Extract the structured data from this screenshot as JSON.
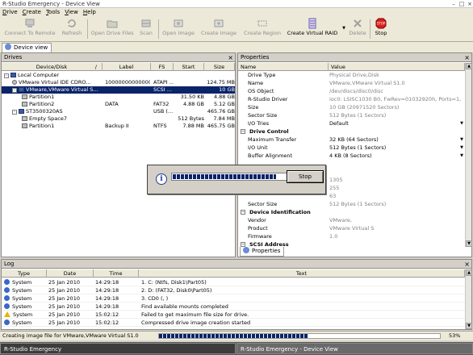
{
  "window": {
    "title": "R-Studio Emergency - Device View"
  },
  "menu": [
    "Drive",
    "Create",
    "Tools",
    "View",
    "Help"
  ],
  "toolbar": {
    "connect": "Connect To Remote",
    "refresh": "Refresh",
    "open_drive_files": "Open Drive Files",
    "scan": "Scan",
    "open_image": "Open Image",
    "create_image": "Create Image",
    "create_region": "Create Region",
    "create_virtual_raid": "Create Virtual RAID",
    "delete": "Delete",
    "stop": "Stop"
  },
  "tabs": {
    "device_view": "Device view",
    "properties": "Properties"
  },
  "drives": {
    "title": "Drives",
    "columns": {
      "device": "Device/Disk",
      "sort": "/",
      "label": "Label",
      "fs": "FS",
      "start": "Start",
      "size": "Size"
    },
    "rows": [
      {
        "expander": "-",
        "name": "Local Computer",
        "label": "",
        "fs": "",
        "start": "",
        "size": ""
      },
      {
        "expander": "",
        "name": "VMware Virtual IDE CDRO...",
        "label": "10000000000000...",
        "fs": "ATAPI ...",
        "start": "",
        "size": "124.75 MB"
      },
      {
        "expander": "-",
        "name": "VMware,VMware Virtual S...",
        "label": "",
        "fs": "SCSI ...",
        "start": "",
        "size": "10 GB"
      },
      {
        "expander": "",
        "name": "Partition1",
        "label": "",
        "fs": "",
        "start": "31.50 KB",
        "size": "4.88 GB"
      },
      {
        "expander": "",
        "name": "Partition2",
        "label": "DATA",
        "fs": "FAT32",
        "start": "4.88 GB",
        "size": "5.12 GB"
      },
      {
        "expander": "-",
        "name": "ST3500320AS",
        "label": "",
        "fs": "USB (...",
        "start": "",
        "size": "465.76 GB"
      },
      {
        "expander": "",
        "name": "Empty Space7",
        "label": "",
        "fs": "",
        "start": "512 Bytes",
        "size": "7.84 MB"
      },
      {
        "expander": "",
        "name": "Partition1",
        "label": "Backup II",
        "fs": "NTFS",
        "start": "7.88 MB",
        "size": "465.75 GB"
      }
    ]
  },
  "properties": {
    "title": "Properties",
    "columns": {
      "name": "Name",
      "value": "Value"
    },
    "rows": [
      {
        "type": "prop",
        "name": "Drive Type",
        "value": "Physical Drive,Disk"
      },
      {
        "type": "prop",
        "name": "Name",
        "value": "VMware,VMware Virtual S1.0"
      },
      {
        "type": "prop",
        "name": "OS Object",
        "value": "/dev/discs/disc0/disc"
      },
      {
        "type": "prop",
        "name": "R-Studio Driver",
        "value": "ioc0: LSISC1030 B0, FwRev=01032920h, Ports=1,..."
      },
      {
        "type": "prop",
        "name": "Size",
        "value": "10 GB (20971520 Sectors)"
      },
      {
        "type": "prop",
        "name": "Sector Size",
        "value": "512 Bytes (1 Sectors)"
      },
      {
        "type": "edit",
        "name": "I/O Tries",
        "value": "Default"
      },
      {
        "type": "group",
        "name": "Drive Control",
        "value": ""
      },
      {
        "type": "edit",
        "name": "Maximum Transfer",
        "value": "32 KB (64 Sectors)"
      },
      {
        "type": "edit",
        "name": "I/O Unit",
        "value": "512 Bytes (1 Sectors)"
      },
      {
        "type": "edit",
        "name": "Buffer Alignment",
        "value": "4 KB (8 Sectors)"
      },
      {
        "type": "prop",
        "name": "",
        "value": ""
      },
      {
        "type": "prop",
        "name": "",
        "value": ""
      },
      {
        "type": "prop",
        "name": "",
        "value": "1305"
      },
      {
        "type": "prop",
        "name": "",
        "value": "255"
      },
      {
        "type": "prop",
        "name": "",
        "value": "63"
      },
      {
        "type": "prop",
        "name": "Sector Size",
        "value": "512 Bytes (1 Sectors)"
      },
      {
        "type": "group",
        "name": "Device Identification",
        "value": ""
      },
      {
        "type": "prop",
        "name": "Vendor",
        "value": "VMware,"
      },
      {
        "type": "prop",
        "name": "Product",
        "value": "VMware Virtual S"
      },
      {
        "type": "prop",
        "name": "Firmware",
        "value": "1.0"
      },
      {
        "type": "group",
        "name": "SCSI Address",
        "value": ""
      }
    ]
  },
  "progress_popup": {
    "stop_label": "Stop",
    "progress": 0.85
  },
  "log": {
    "title": "Log",
    "columns": {
      "type": "Type",
      "date": "Date",
      "time": "Time",
      "text": "Text"
    },
    "rows": [
      {
        "icon": "info",
        "type": "System",
        "date": "25 Jan 2010",
        "time": "14:29:18",
        "text": "1. C: (Ntfs, Disk1\\Part05)"
      },
      {
        "icon": "info",
        "type": "System",
        "date": "25 Jan 2010",
        "time": "14:29:18",
        "text": "2. D: (FAT32, Disk0\\Part05)"
      },
      {
        "icon": "info",
        "type": "System",
        "date": "25 Jan 2010",
        "time": "14:29:18",
        "text": "3. CD0 (, )"
      },
      {
        "icon": "info",
        "type": "System",
        "date": "25 Jan 2010",
        "time": "14:29:18",
        "text": "Find available mounts completed"
      },
      {
        "icon": "warn",
        "type": "System",
        "date": "25 Jan 2010",
        "time": "15:02:12",
        "text": "Failed to get maximum file size for drive."
      },
      {
        "icon": "info",
        "type": "System",
        "date": "25 Jan 2010",
        "time": "15:02:12",
        "text": "Compressed drive image creation started"
      }
    ]
  },
  "status": {
    "text": "Creating image file for VMware,VMware Virtual S1.0",
    "percent": "53%",
    "progress": 0.53
  },
  "taskbar": {
    "left": "R-Studio Emergency",
    "right": "R-Studio Emergency - Device View"
  }
}
